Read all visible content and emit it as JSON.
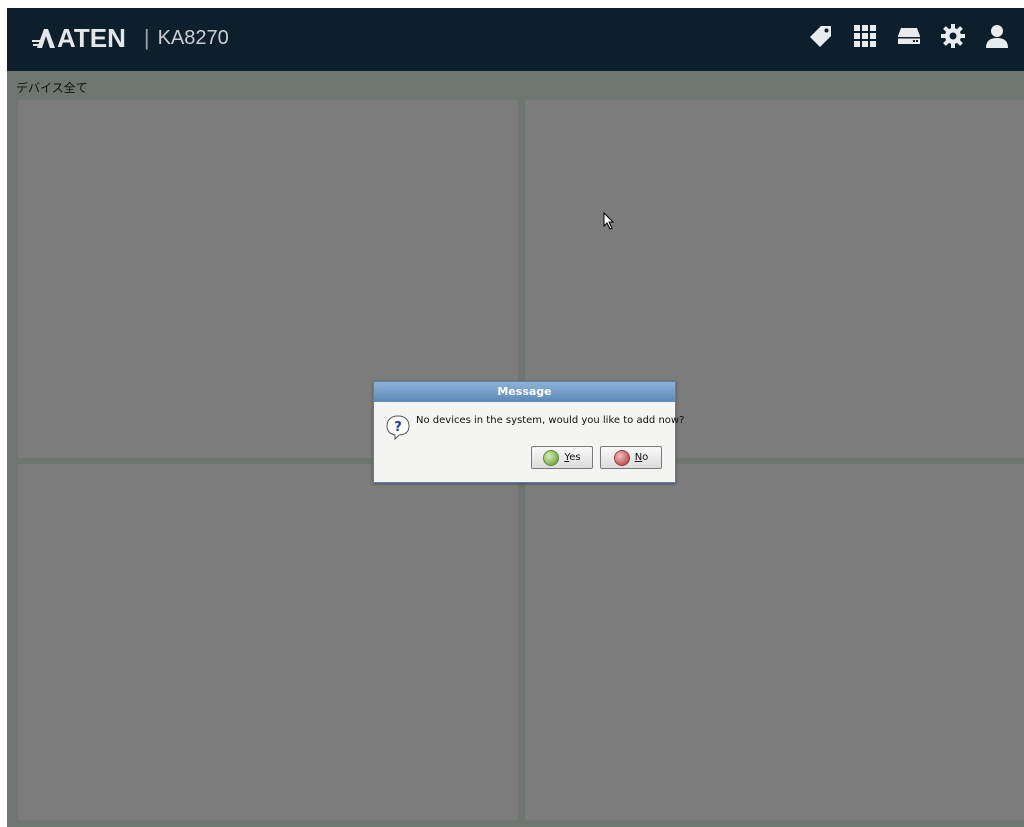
{
  "header": {
    "brand": "ATEN",
    "separator": "|",
    "model": "KA8270",
    "icons": [
      "tag-icon",
      "grid-icon",
      "drive-icon",
      "gear-icon",
      "user-icon"
    ]
  },
  "main": {
    "group_label": "デバイス全て",
    "panels": [
      "",
      "",
      "",
      ""
    ]
  },
  "dialog": {
    "title": "Message",
    "message": "No devices in the system, would you like to add now?",
    "yes_label": "Yes",
    "no_label": "No"
  },
  "colors": {
    "header_bg": "#0e1f2c",
    "panel_bg": "#7c7c7c",
    "divider": "#6f7570",
    "dialog_title": "#5c88b8"
  }
}
